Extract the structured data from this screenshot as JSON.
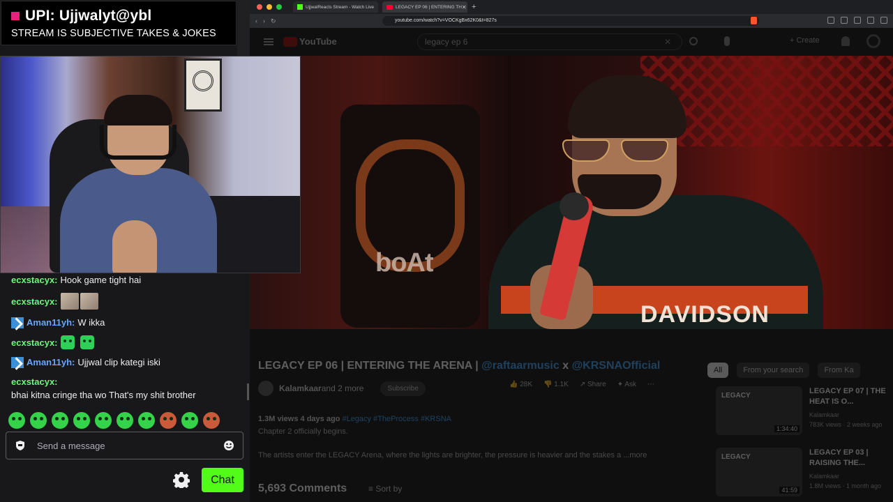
{
  "upi_banner": {
    "title": "UPI: Ujjwalyt@ybl",
    "subtitle": "STREAM IS SUBJECTIVE TAKES & JOKES",
    "accent_color": "#e8207a"
  },
  "chat": {
    "messages": [
      {
        "user": "ecxstacyx:",
        "text": "Hook game tight hai",
        "color": "#6bf87b",
        "badge": false
      },
      {
        "user": "ecxstacyx:",
        "text": "",
        "color": "#6bf87b",
        "badge": false,
        "emote": "photo-emote"
      },
      {
        "user": "Aman11yh:",
        "text": "W ikka",
        "color": "#6ba5f8",
        "badge": true
      },
      {
        "user": "ecxstacyx:",
        "text": "",
        "color": "#6bf87b",
        "badge": false,
        "emote": "green-face-emote"
      },
      {
        "user": "Aman11yh:",
        "text": "Ujjwal clip kategi iski",
        "color": "#6ba5f8",
        "badge": true
      },
      {
        "user": "ecxstacyx:",
        "text": "bhai kitna cringe tha wo That's my shit brother",
        "color": "#6bf87b",
        "badge": false
      }
    ],
    "input_placeholder": "Send a message",
    "send_label": "Chat",
    "send_color": "#53fc18"
  },
  "browser": {
    "tabs": [
      {
        "label": "UjjwalReacts Stream - Watch Live",
        "favicon": "kick-icon"
      },
      {
        "label": "LEGACY EP 06 | ENTERING TH",
        "favicon": "youtube-icon"
      }
    ],
    "new_tab_glyph": "+",
    "url": "youtube.com/watch?v=VOCKgBx62K0&t=827s"
  },
  "youtube": {
    "logo_text": "YouTube",
    "search_value": "legacy ep 6",
    "create_label": "+ Create",
    "video_overlay_brand": "boAt",
    "video_overlay_jacket": "DAVIDSON",
    "title_prefix": "LEGACY EP 06 | ENTERING THE ARENA | ",
    "title_mention_1": "@raftaarmusic",
    "title_joiner": " x ",
    "title_mention_2": "@KRSNAOfficial",
    "channel": "Kalamkaar",
    "channel_more": " and 2 more",
    "subscribe_label": "Subscribe",
    "likes": "28K",
    "dislikes": "1.1K",
    "share_label": "Share",
    "ask_label": "Ask",
    "views_meta": "1.3M views  4 days ago  ",
    "hashtags": "#Legacy #TheProcess #KRSNA",
    "desc_line2": "Chapter 2 officially begins.",
    "desc_line3": "The artists enter the LEGACY Arena, where the lights are brighter, the pressure is heavier and the stakes a ...more",
    "comments": "5,693 Comments",
    "sort_label": "Sort by",
    "chips": [
      "All",
      "From your search",
      "From Ka"
    ],
    "recommendations": [
      {
        "thumb_label": "LEGACY",
        "duration": "1:34:40",
        "title": "LEGACY EP 07 | THE HEAT IS O...",
        "channel": "Kalamkaar",
        "meta": "783K views · 2 weeks ago"
      },
      {
        "thumb_label": "LEGACY",
        "duration": "41:59",
        "title": "LEGACY EP 03 | RAISING THE...",
        "channel": "Kalamkaar",
        "meta": "1.8M views · 1 month ago"
      }
    ]
  }
}
